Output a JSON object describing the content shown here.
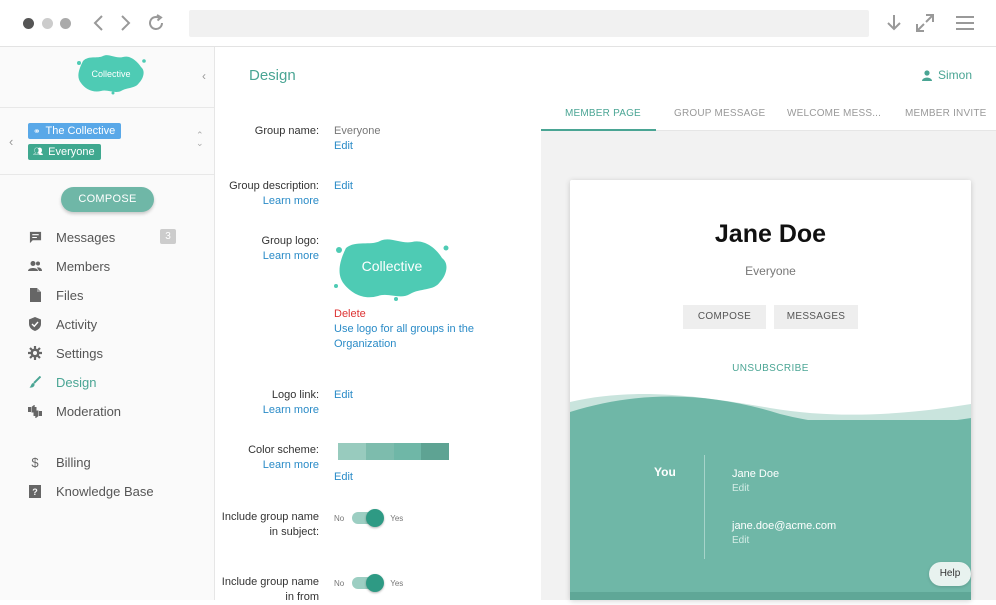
{
  "app": {
    "logo_text": "Collective",
    "accent_color": "#4aa594",
    "page_title": "Design",
    "user_name": "Simon"
  },
  "sidebar": {
    "group_tags": [
      {
        "label": "The Collective",
        "icon": "link-icon",
        "color": "#59a8e8"
      },
      {
        "label": "Everyone",
        "icon": "people-icon",
        "color": "#3fa88f"
      }
    ],
    "compose_label": "COMPOSE",
    "items": [
      {
        "label": "Messages",
        "icon": "chat-icon",
        "badge": "3"
      },
      {
        "label": "Members",
        "icon": "people-icon"
      },
      {
        "label": "Files",
        "icon": "file-icon"
      },
      {
        "label": "Activity",
        "icon": "shield-icon"
      },
      {
        "label": "Settings",
        "icon": "gear-icon"
      },
      {
        "label": "Design",
        "icon": "brush-icon",
        "active": true
      },
      {
        "label": "Moderation",
        "icon": "thumbs-icon"
      },
      {
        "label": "Billing",
        "icon": "dollar-icon"
      },
      {
        "label": "Knowledge Base",
        "icon": "help-icon"
      }
    ]
  },
  "form": {
    "group_name": {
      "label": "Group name:",
      "value": "Everyone",
      "edit": "Edit"
    },
    "group_description": {
      "label": "Group description:",
      "learn_more": "Learn more",
      "edit": "Edit"
    },
    "group_logo": {
      "label": "Group logo:",
      "learn_more": "Learn more",
      "delete": "Delete",
      "use_logo": "Use logo for all groups in the Organization"
    },
    "logo_link": {
      "label": "Logo link:",
      "learn_more": "Learn more",
      "edit": "Edit"
    },
    "color_scheme": {
      "label": "Color scheme:",
      "learn_more": "Learn more",
      "edit": "Edit",
      "swatches": [
        "#98cbbe",
        "#7dbcad",
        "#6fb7a7",
        "#5ea393"
      ]
    },
    "include_subject": {
      "label": "Include group name in subject:",
      "off": "No",
      "on": "Yes",
      "value": true
    },
    "include_from": {
      "label": "Include group name in from",
      "off": "No",
      "on": "Yes",
      "value": true
    }
  },
  "preview": {
    "tabs": [
      "MEMBER PAGE",
      "GROUP MESSAGE",
      "WELCOME MESS...",
      "MEMBER INVITE"
    ],
    "active_tab": 0,
    "member_name": "Jane Doe",
    "group": "Everyone",
    "compose_label": "COMPOSE",
    "messages_label": "MESSAGES",
    "unsubscribe_label": "UNSUBSCRIBE",
    "you_label": "You",
    "name_value": "Jane Doe",
    "name_edit": "Edit",
    "email_value": "jane.doe@acme.com",
    "email_edit": "Edit"
  },
  "help_label": "Help"
}
